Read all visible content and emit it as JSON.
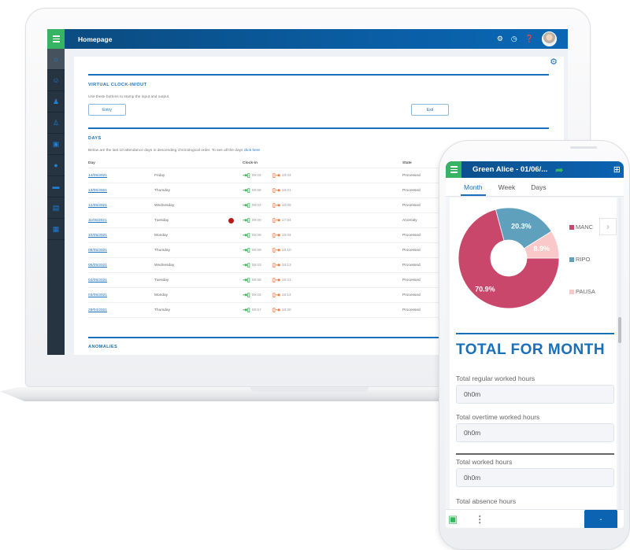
{
  "desktop": {
    "header": {
      "title": "Homepage",
      "icons": [
        "gear-icon",
        "clock-icon",
        "help-icon",
        "avatar"
      ]
    },
    "sidebar": {
      "items": [
        {
          "icon": "home-icon",
          "active": true
        },
        {
          "icon": "user-search-icon",
          "active": false
        },
        {
          "icon": "users-icon",
          "active": false
        },
        {
          "icon": "user-settings-icon",
          "active": false
        },
        {
          "icon": "monitor-icon",
          "active": false
        },
        {
          "icon": "clock-circle-icon",
          "active": false
        },
        {
          "icon": "message-icon",
          "active": false
        },
        {
          "icon": "report-icon",
          "active": false
        },
        {
          "icon": "calendar-icon",
          "active": false
        }
      ]
    },
    "clock_section": {
      "title": "VIRTUAL CLOCK-IN/OUT",
      "description": "Use these buttons to stamp the input and output.",
      "entry_label": "Entry",
      "exit_label": "Exit"
    },
    "days_section": {
      "title": "DAYS",
      "description": "Below are the last 10 attendance days in descending chronological order. To see all the days ",
      "link_text": "click here",
      "columns": {
        "day": "Day",
        "clock_in": "Clock-in",
        "state": "State"
      },
      "rows": [
        {
          "date": "14/05/2021",
          "weekday": "Friday",
          "anomaly": false,
          "in": "09:02",
          "out": "18:04",
          "state": "Processed"
        },
        {
          "date": "13/05/2021",
          "weekday": "Thursday",
          "anomaly": false,
          "in": "08:58",
          "out": "18:01",
          "state": "Processed"
        },
        {
          "date": "12/05/2021",
          "weekday": "Wednesday",
          "anomaly": false,
          "in": "09:02",
          "out": "18:05",
          "state": "Processed"
        },
        {
          "date": "11/05/2021",
          "weekday": "Tuesday",
          "anomaly": true,
          "in": "09:00",
          "out": "17:54",
          "state": "Anomaly"
        },
        {
          "date": "10/05/2021",
          "weekday": "Monday",
          "anomaly": false,
          "in": "09:08",
          "out": "18:04",
          "state": "Processed"
        },
        {
          "date": "06/05/2021",
          "weekday": "Thursday",
          "anomaly": false,
          "in": "08:59",
          "out": "18:10",
          "state": "Processed"
        },
        {
          "date": "05/05/2021",
          "weekday": "Wednesday",
          "anomaly": false,
          "in": "09:03",
          "out": "18:13",
          "state": "Processed"
        },
        {
          "date": "04/05/2021",
          "weekday": "Tuesday",
          "anomaly": false,
          "in": "08:58",
          "out": "18:21",
          "state": "Processed"
        },
        {
          "date": "03/05/2021",
          "weekday": "Monday",
          "anomaly": false,
          "in": "09:02",
          "out": "18:14",
          "state": "Processed"
        },
        {
          "date": "29/04/2021",
          "weekday": "Thursday",
          "anomaly": false,
          "in": "08:57",
          "out": "18:20",
          "state": "Processed"
        }
      ]
    },
    "anomalies_section": {
      "title": "ANOMALIES"
    }
  },
  "mobile": {
    "header": {
      "title": "Green Alice - 01/06/..."
    },
    "tabs": [
      {
        "label": "Month",
        "active": true
      },
      {
        "label": "Week",
        "active": false
      },
      {
        "label": "Days",
        "active": false
      }
    ],
    "colors": {
      "MANC": "#c8476a",
      "RIPO": "#5fa0bd",
      "PAUSA": "#fac8c8"
    },
    "total_heading": "TOTAL FOR MONTH",
    "fields": [
      {
        "label": "Total regular worked hours",
        "value": "0h0m"
      },
      {
        "label": "Total overtime worked hours",
        "value": "0h0m"
      },
      {
        "label": "Total worked hours",
        "value": "0h0m"
      },
      {
        "label": "Total absence hours",
        "value": ""
      }
    ]
  },
  "chart_data": {
    "type": "pie",
    "donut": true,
    "categories": [
      "MANC",
      "RIPO",
      "PAUSA"
    ],
    "values": [
      70.9,
      20.3,
      8.9
    ],
    "labels": [
      "70.9%",
      "20.3%",
      "8.9%"
    ],
    "legend": "right"
  }
}
